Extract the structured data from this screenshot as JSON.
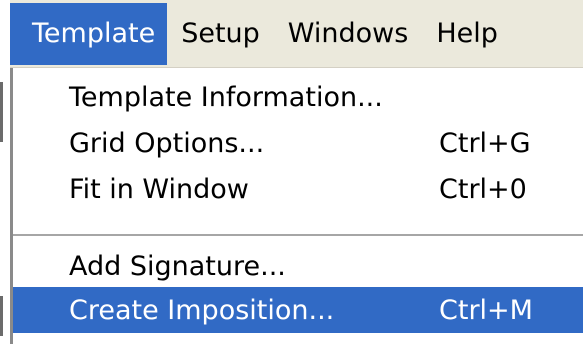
{
  "menubar": {
    "items": [
      {
        "label": "Template"
      },
      {
        "label": "Setup"
      },
      {
        "label": "Windows"
      },
      {
        "label": "Help"
      }
    ]
  },
  "menu": {
    "items": [
      {
        "label": "Template Information...",
        "shortcut": ""
      },
      {
        "label": "Grid Options...",
        "shortcut": "Ctrl+G"
      },
      {
        "label": "Fit in Window",
        "shortcut": "Ctrl+0"
      },
      {
        "label": "Add Signature...",
        "shortcut": ""
      },
      {
        "label": "Create Imposition...",
        "shortcut": "Ctrl+M"
      }
    ]
  },
  "colors": {
    "highlight": "#316ac5",
    "menubar_bg": "#ebe9dc"
  }
}
